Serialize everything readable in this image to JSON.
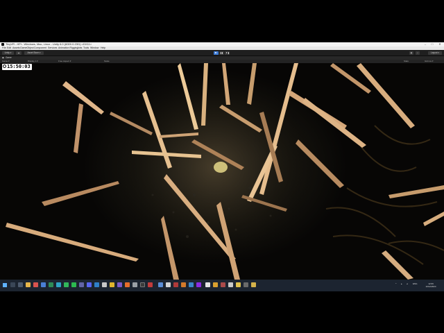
{
  "window": {
    "title": "TinyVR - HFt - Windows, Mac, Linux - Unity 6.0 (6000.0.23f1) <DX11>",
    "controls": [
      "–",
      "□",
      "✕"
    ]
  },
  "menu": [
    "File",
    "Edit",
    "Assets",
    "GameObject",
    "Component",
    "Services",
    "Animation Rigging",
    "Jobs",
    "Tools",
    "Window",
    "Help"
  ],
  "toolbar": {
    "account_label": "Unity ▾",
    "cloud_label": "☁",
    "services_label": "Asset Store ▾",
    "layout_label": "Layout ▾"
  },
  "tabs": {
    "scene_tab": "Game"
  },
  "game_bar": {
    "display": "Game ▾",
    "target": "Display 1 ▾",
    "aspect": "Free Aspect ▾",
    "scale": "Scale",
    "stats": "Stats",
    "gizmos": "Gizmos ▾"
  },
  "overlay": {
    "timer": "15:50:03"
  },
  "colors": {
    "play_active": "#3d7bd4",
    "taskbar": "#1c2430",
    "grass_highlight": "#e9c08a",
    "grass_mid": "#b8865a"
  },
  "tray": {
    "language": "ENG",
    "time": "12:09",
    "date": "10/12/2024"
  }
}
